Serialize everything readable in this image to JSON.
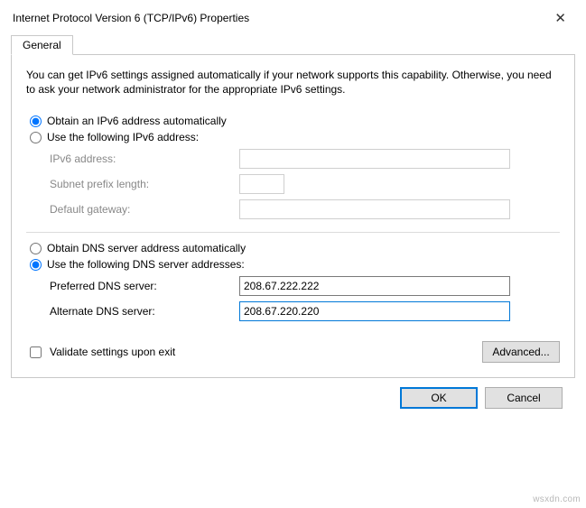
{
  "window": {
    "title": "Internet Protocol Version 6 (TCP/IPv6) Properties"
  },
  "tabs": {
    "general": "General"
  },
  "intro": "You can get IPv6 settings assigned automatically if your network supports this capability. Otherwise, you need to ask your network administrator for the appropriate IPv6 settings.",
  "address_section": {
    "auto_label": "Obtain an IPv6 address automatically",
    "manual_label": "Use the following IPv6 address:",
    "selected": "auto",
    "fields": {
      "ipv6_address": {
        "label": "IPv6 address:",
        "value": ""
      },
      "subnet_prefix": {
        "label": "Subnet prefix length:",
        "value": ""
      },
      "default_gateway": {
        "label": "Default gateway:",
        "value": ""
      }
    }
  },
  "dns_section": {
    "auto_label": "Obtain DNS server address automatically",
    "manual_label": "Use the following DNS server addresses:",
    "selected": "manual",
    "fields": {
      "preferred": {
        "label": "Preferred DNS server:",
        "value": "208.67.222.222"
      },
      "alternate": {
        "label": "Alternate DNS server:",
        "value": "208.67.220.220"
      }
    }
  },
  "validate_checkbox": {
    "label": "Validate settings upon exit",
    "checked": false
  },
  "buttons": {
    "advanced": "Advanced...",
    "ok": "OK",
    "cancel": "Cancel"
  },
  "watermark": "wsxdn.com"
}
